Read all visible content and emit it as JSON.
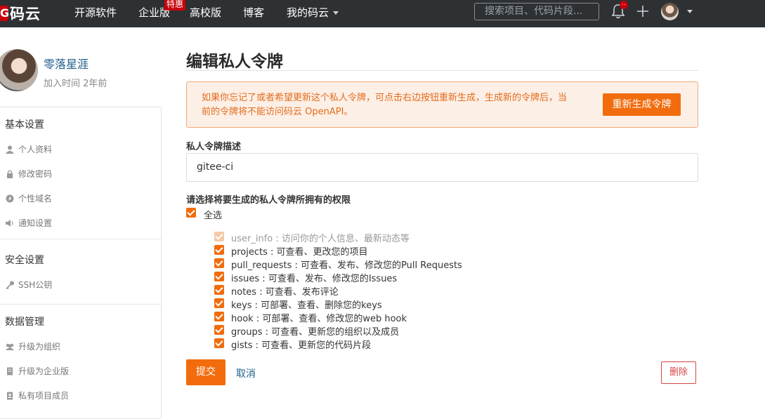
{
  "nav": {
    "logo_badge": "G",
    "logo_text": "码云",
    "items": [
      "开源软件",
      "企业版",
      "高校版",
      "博客",
      "我的码云"
    ],
    "enterprise_badge": "特惠",
    "search_placeholder": "搜索项目、代码片段...",
    "notification_count": "..",
    "bell_icon": "bell-icon",
    "plus_icon": "plus-icon"
  },
  "profile": {
    "name": "零落星涯",
    "joined": "加入时间 2年前"
  },
  "sidebar": {
    "sections": [
      {
        "heading": "基本设置",
        "items": [
          "个人资料",
          "修改密码",
          "个性域名",
          "通知设置"
        ]
      },
      {
        "heading": "安全设置",
        "items": [
          "SSH公钥"
        ]
      },
      {
        "heading": "数据管理",
        "items": [
          "升级为组织",
          "升级为企业版",
          "私有项目成员"
        ]
      }
    ]
  },
  "main": {
    "title": "编辑私人令牌",
    "notice_text": "如果你忘记了或者希望更新这个私人令牌，可点击右边按钮重新生成，生成新的令牌后，当前的令牌将不能访问码云 OpenAPI。",
    "regenerate_button": "重新生成令牌",
    "description_label": "私人令牌描述",
    "description_value": "gitee-ci",
    "scopes_label": "请选择将要生成的私人令牌所拥有的权限",
    "select_all_label": "全选",
    "scopes": [
      {
        "label": "user_info : 访问你的个人信息、最新动态等",
        "checked": true,
        "disabled": true
      },
      {
        "label": "projects : 可查看、更改您的项目",
        "checked": true,
        "disabled": false
      },
      {
        "label": "pull_requests : 可查看、发布、修改您的Pull Requests",
        "checked": true,
        "disabled": false
      },
      {
        "label": "issues : 可查看、发布、修改您的Issues",
        "checked": true,
        "disabled": false
      },
      {
        "label": "notes : 可查看、发布评论",
        "checked": true,
        "disabled": false
      },
      {
        "label": "keys : 可部署、查看、删除您的keys",
        "checked": true,
        "disabled": false
      },
      {
        "label": "hook : 可部署、查看、修改您的web hook",
        "checked": true,
        "disabled": false
      },
      {
        "label": "groups : 可查看、更新您的组织以及成员",
        "checked": true,
        "disabled": false
      },
      {
        "label": "gists : 可查看、更新您的代码片段",
        "checked": true,
        "disabled": false
      }
    ],
    "submit_button": "提交",
    "cancel_link": "取消",
    "delete_button": "删除"
  },
  "colors": {
    "accent": "#f26c0d",
    "nav_bg": "#2e3134",
    "link": "#1f5e8a",
    "danger": "#d64545"
  }
}
